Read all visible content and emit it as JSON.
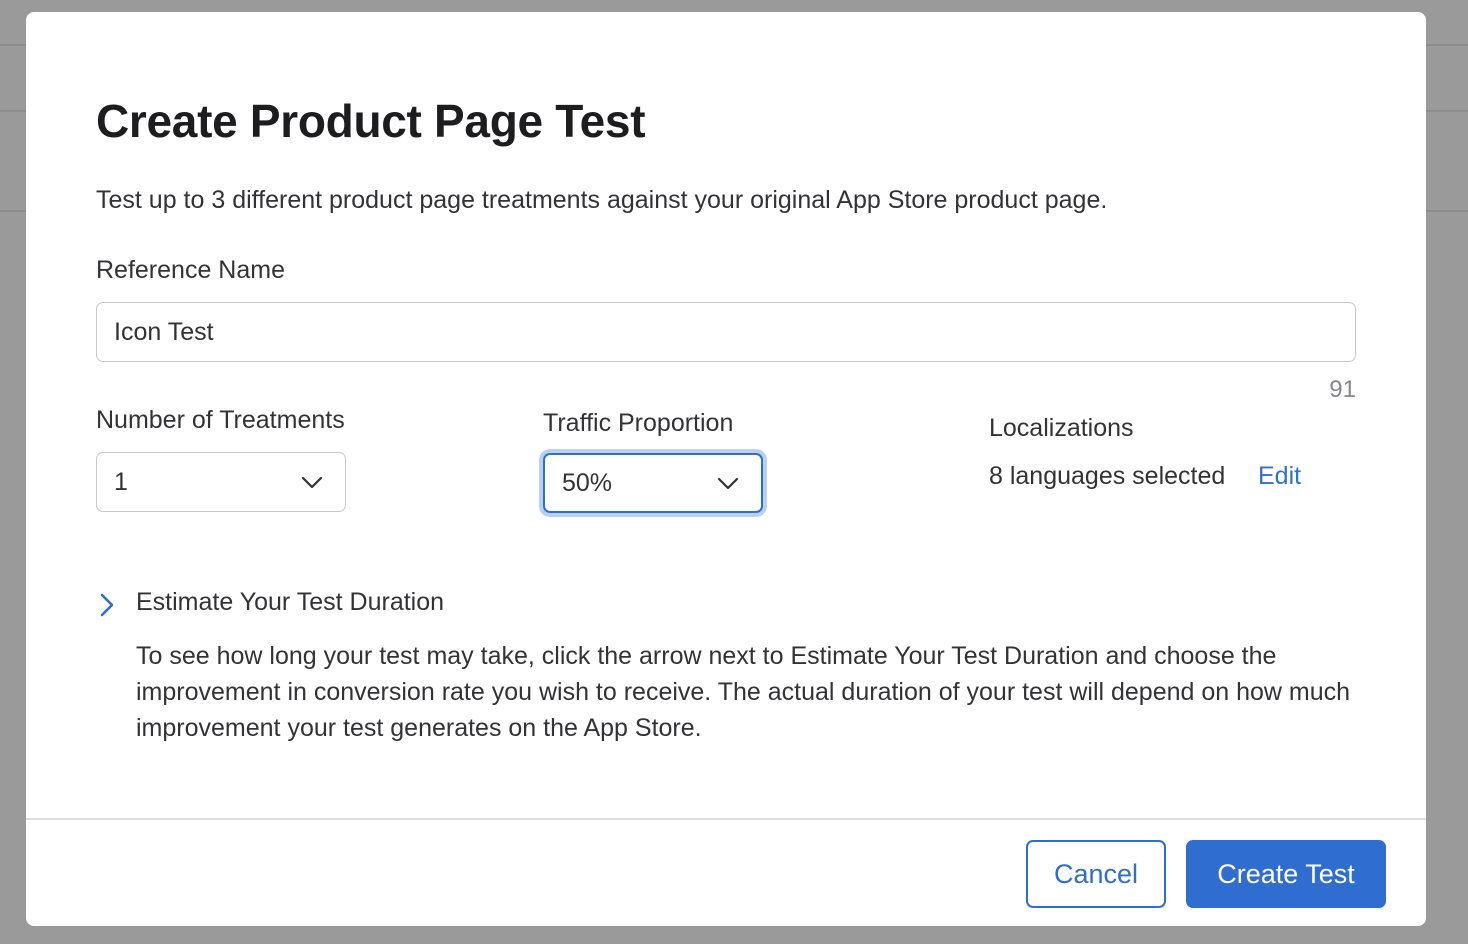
{
  "dialog": {
    "title": "Create Product Page Test",
    "subtitle": "Test up to 3 different product page treatments against your original App Store product page."
  },
  "reference_name": {
    "label": "Reference Name",
    "value": "Icon Test",
    "remaining_chars": "91"
  },
  "treatments": {
    "label": "Number of Treatments",
    "selected": "1"
  },
  "traffic": {
    "label": "Traffic Proportion",
    "selected": "50%"
  },
  "localizations": {
    "label": "Localizations",
    "summary": "8 languages selected",
    "edit_label": "Edit"
  },
  "estimate": {
    "title": "Estimate Your Test Duration",
    "body": "To see how long your test may take, click the arrow next to Estimate Your Test Duration and choose the improvement in conversion rate you wish to receive. The actual duration of your test will depend on how much improvement your test generates on the App Store."
  },
  "footer": {
    "cancel_label": "Cancel",
    "create_label": "Create Test"
  },
  "colors": {
    "accent": "#2f6dd0",
    "link": "#2f72c9",
    "backdrop": "#9a9a9a"
  },
  "icons": {
    "dropdown": "chevron-down-icon",
    "disclosure": "chevron-right-icon"
  }
}
